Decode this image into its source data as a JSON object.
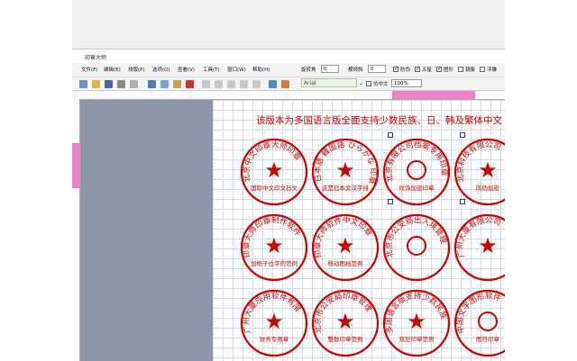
{
  "window": {
    "title": "印章大师"
  },
  "menu": [
    "文件(F)",
    "编辑(E)",
    "排版(P)",
    "选项(O)",
    "查看(V)",
    "工具(T)",
    "窗口(W)",
    "帮助(H)"
  ],
  "props": {
    "rotate_label": "旋转角",
    "rotate_value": "0",
    "skew_label": "横倾斜",
    "skew_value": "0",
    "checks": [
      {
        "label": "防伪",
        "on": true
      },
      {
        "label": "五星",
        "on": true
      },
      {
        "label": "图形",
        "on": true
      },
      {
        "label": "镜像",
        "on": false
      },
      {
        "label": "浮雕",
        "on": false
      }
    ]
  },
  "toolbar": {
    "font": "Arial",
    "vertical_label": "仿中文",
    "zoom": "100%"
  },
  "canvas": {
    "headline": "该版本为多国语言版全面支持少数民族、日、韩及繁体中文"
  },
  "seals": [
    {
      "ring": "北京中文印章大师印章",
      "inner": "国际中文印文日文印章制作",
      "star": true
    },
    {
      "ring": "日本語 韓国語 ひらがな 印章",
      "inner": "这是日本文汉字排版样文",
      "star": true
    },
    {
      "ring": "北京有限公司档案专用印章",
      "inner": "纹饰加密印章",
      "star": false
    },
    {
      "ring": "北京科技有限公司",
      "inner": "防伪加密",
      "star": true
    },
    {
      "ring": "印章大师印章制作软件",
      "inner": "加框子位字的范例",
      "star": true
    },
    {
      "ring": "印章大师软件中文印章",
      "inner": "移动图档范例",
      "star": true
    },
    {
      "ring": "北京市公安局出入境管理",
      "inner": "",
      "star": false
    },
    {
      "ring": "广州大厦有限公司",
      "inner": "",
      "star": true
    },
    {
      "ring": "广州大厦应用软件有限",
      "inner": "财务专用章",
      "star": true
    },
    {
      "ring": "北京市公安局印章管理",
      "inner": "整数印章范例",
      "star": true
    },
    {
      "ring": "多国语言版支持少数民族",
      "inner": "双层印章范例",
      "star": true
    },
    {
      "ring": "中国文字图形软件",
      "inner": "图符印章",
      "star": false
    }
  ]
}
